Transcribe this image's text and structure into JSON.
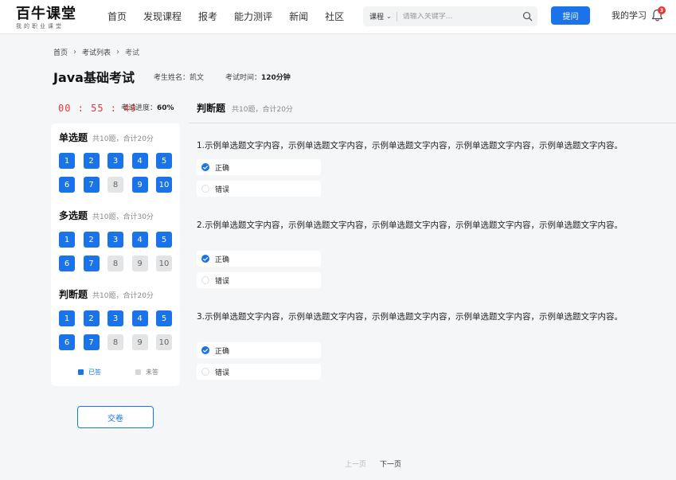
{
  "header": {
    "logo_title": "百牛课堂",
    "logo_sub": "我的职业课堂",
    "nav": [
      "首页",
      "发现课程",
      "报考",
      "能力测评",
      "新闻",
      "社区"
    ],
    "search_type": "课程",
    "search_placeholder": "请输入关键字...",
    "ask_label": "提问",
    "my_study": "我的学习",
    "notification_count": "3"
  },
  "breadcrumb": [
    "首页",
    "考试列表",
    "考试"
  ],
  "exam": {
    "title": "Java基础考试",
    "candidate_label": "考生姓名：",
    "candidate_name": "凯文",
    "time_label": "考试时间：",
    "time_value": "120分钟",
    "timer": "00 : 55 : 49",
    "progress_label": "考试进度：",
    "progress_value": "60%",
    "progress_fraction": 0.6
  },
  "sidebar": {
    "sections": [
      {
        "title": "单选题",
        "summary": "共10题，合计20分",
        "numbers": [
          "1",
          "2",
          "3",
          "4",
          "5",
          "6",
          "7",
          "8",
          "9",
          "10"
        ],
        "answered": [
          true,
          true,
          true,
          true,
          true,
          true,
          true,
          false,
          true,
          true
        ]
      },
      {
        "title": "多选题",
        "summary": "共10题，合计30分",
        "numbers": [
          "1",
          "2",
          "3",
          "4",
          "5",
          "6",
          "7",
          "8",
          "9",
          "10"
        ],
        "answered": [
          true,
          true,
          true,
          true,
          true,
          true,
          true,
          false,
          false,
          false
        ]
      },
      {
        "title": "判断题",
        "summary": "共10题，合计20分",
        "numbers": [
          "1",
          "2",
          "3",
          "4",
          "5",
          "6",
          "7",
          "8",
          "9",
          "10"
        ],
        "answered": [
          true,
          true,
          true,
          true,
          true,
          true,
          true,
          false,
          false,
          false
        ]
      }
    ],
    "legend_done": "已答",
    "legend_todo": "未答",
    "submit_label": "交卷"
  },
  "main": {
    "section_title": "判断题",
    "section_summary": "共10题，合计20分",
    "questions": [
      {
        "text": "1.示例单选题文字内容，示例单选题文字内容，示例单选题文字内容，示例单选题文字内容，示例单选题文字内容。",
        "options": [
          "正确",
          "错误"
        ],
        "selected": 0
      },
      {
        "text": "2.示例单选题文字内容，示例单选题文字内容，示例单选题文字内容，示例单选题文字内容，示例单选题文字内容。",
        "options": [
          "正确",
          "错误"
        ],
        "selected": 0
      },
      {
        "text": "3.示例单选题文字内容，示例单选题文字内容，示例单选题文字内容，示例单选题文字内容，示例单选题文字内容。",
        "options": [
          "正确",
          "错误"
        ],
        "selected": 0
      }
    ]
  },
  "pager": {
    "prev": "上一页",
    "next": "下一页"
  },
  "colors": {
    "primary": "#1a73e8",
    "timer": "#e53935",
    "unanswered": "#e3e4e6"
  }
}
